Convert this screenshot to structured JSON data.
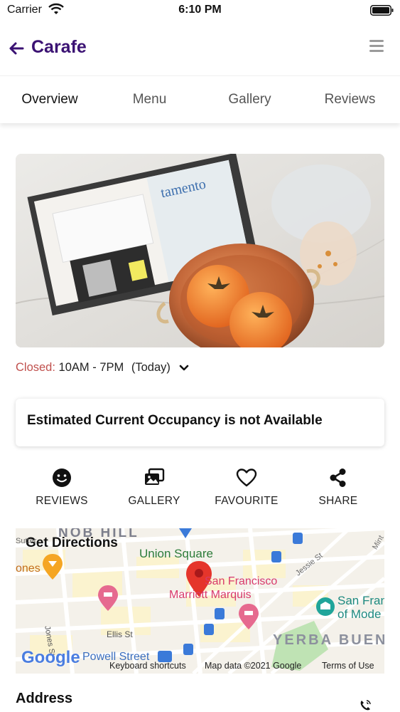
{
  "status_bar": {
    "carrier": "Carrier",
    "time": "6:10 PM"
  },
  "header": {
    "title": "Carafe",
    "title_color": "#3b1273",
    "back_icon": "arrow-left-icon",
    "menu_icon": "hamburger-icon"
  },
  "tabs": [
    {
      "label": "Overview",
      "active": true
    },
    {
      "label": "Menu",
      "active": false
    },
    {
      "label": "Gallery",
      "active": false
    },
    {
      "label": "Reviews",
      "active": false
    }
  ],
  "hours": {
    "status": "Closed:",
    "status_color": "#c0504d",
    "range": "10AM - 7PM",
    "day": "(Today)"
  },
  "occupancy": {
    "text": "Estimated Current Occupancy is not Available"
  },
  "actions": [
    {
      "label": "REVIEWS",
      "icon": "smiley-icon"
    },
    {
      "label": "GALLERY",
      "icon": "photos-icon"
    },
    {
      "label": "FAVOURITE",
      "icon": "heart-icon"
    },
    {
      "label": "SHARE",
      "icon": "share-icon"
    }
  ],
  "map": {
    "title": "Get Directions",
    "labels": {
      "nob_hill": "NOB HILL",
      "union_square": "Union Square",
      "sutter": "Sutter",
      "jones_left": "ones",
      "san_francisco_marriott_1": "San Francisco",
      "san_francisco_marriott_2": "Marriott Marquis",
      "jessie_st": "Jessie St",
      "sf_moma_1": "San Fran",
      "sf_moma_2": "of Mode",
      "ellis_st": "Ellis St",
      "jones_st": "Jones St",
      "yerba_buena": "YERBA BUEN",
      "mint": "Mint",
      "powell_street": "Powell Street"
    },
    "google_logo": "Google",
    "footer": {
      "shortcuts": "Keyboard shortcuts",
      "map_data": "Map data ©2021 Google",
      "terms": "Terms of Use"
    }
  },
  "address": {
    "label": "Address",
    "phone_icon": "phone-icon"
  }
}
